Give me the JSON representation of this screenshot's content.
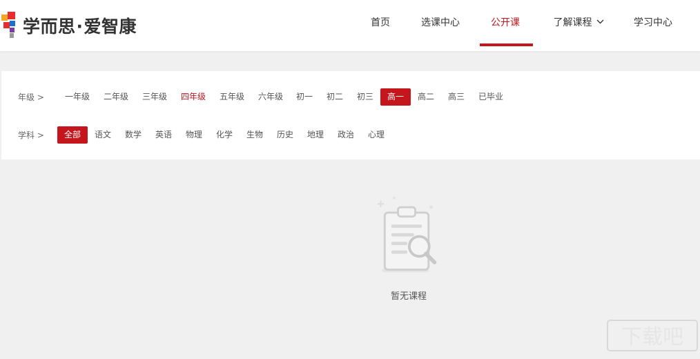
{
  "brand": {
    "name_part1": "学而思",
    "separator": "·",
    "name_part2": "爱智康",
    "colors": {
      "red": "#e72d2e",
      "orange": "#f5a623",
      "blue": "#1d6fce",
      "purple": "#7b3fa0",
      "gray": "#999999"
    }
  },
  "nav": {
    "items": [
      {
        "label": "首页",
        "active": false
      },
      {
        "label": "选课中心",
        "active": false
      },
      {
        "label": "公开课",
        "active": true
      },
      {
        "label": "了解课程",
        "active": false,
        "icon": "chevron-down-icon"
      },
      {
        "label": "学习中心",
        "active": false
      }
    ],
    "accent": "#c4161c"
  },
  "filters": {
    "grade": {
      "label": "年级 >",
      "options": [
        "一年级",
        "二年级",
        "三年级",
        "四年级",
        "五年级",
        "六年级",
        "初一",
        "初二",
        "初三",
        "高一",
        "高二",
        "高三",
        "已毕业"
      ],
      "selected": "高一",
      "highlighted": "四年级"
    },
    "subject": {
      "label": "学科 >",
      "options": [
        "全部",
        "语文",
        "数学",
        "英语",
        "物理",
        "化学",
        "生物",
        "历史",
        "地理",
        "政治",
        "心理"
      ],
      "selected": "全部"
    }
  },
  "empty_state": {
    "icon": "clipboard-search-icon",
    "message": "暂无课程"
  },
  "watermark": {
    "icon": "download-site-watermark-icon",
    "text": "下载吧"
  }
}
